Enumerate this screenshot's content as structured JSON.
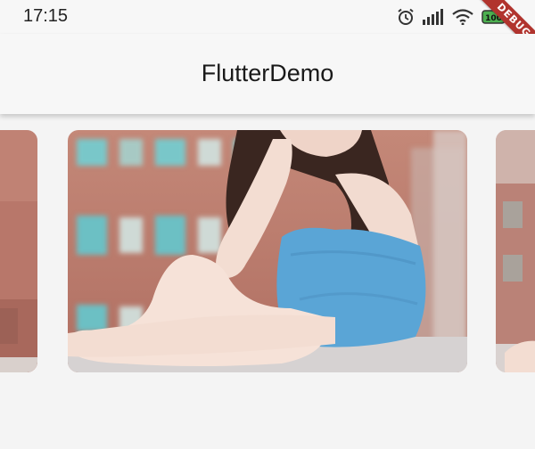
{
  "status_bar": {
    "time": "17:15",
    "icons": [
      "alarm-icon",
      "signal-icon",
      "wifi-icon",
      "battery-icon"
    ],
    "battery_level": "100"
  },
  "debug_banner": {
    "label": "DEBUG"
  },
  "app_bar": {
    "title": "FlutterDemo"
  },
  "carousel": {
    "slides": [
      {
        "name": "previous-slide"
      },
      {
        "name": "current-slide"
      },
      {
        "name": "next-slide"
      }
    ],
    "colors": {
      "building": "#b97a6a",
      "window": "#79c7c9",
      "dress": "#5aa5d6",
      "skin": "#f3ddd2",
      "hair": "#3a2620"
    }
  }
}
